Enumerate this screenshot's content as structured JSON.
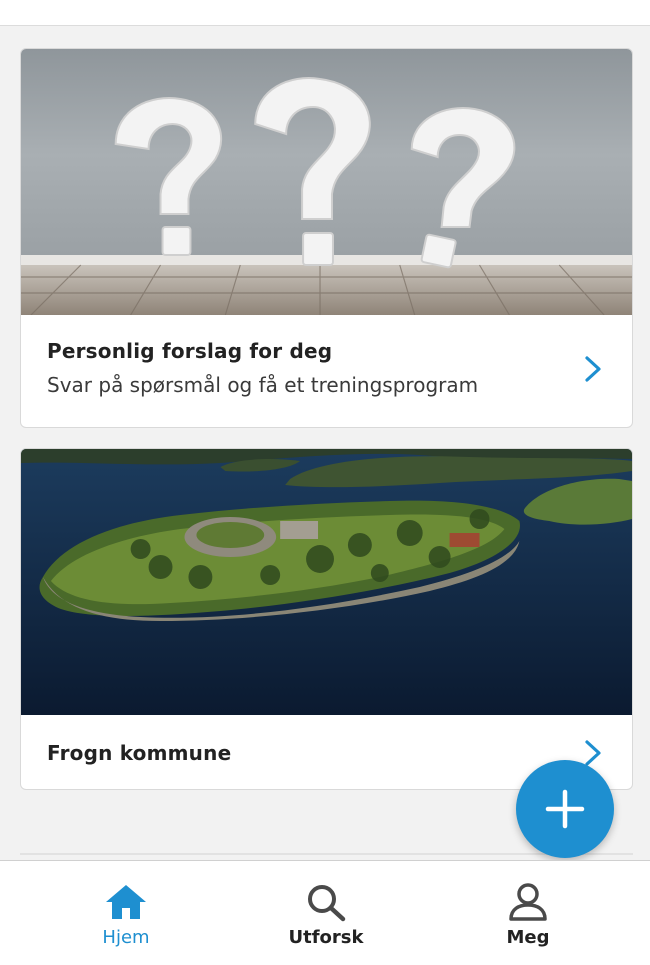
{
  "colors": {
    "accent": "#1e8fd0",
    "text_primary": "#222222",
    "text_secondary": "#3a3a3a",
    "background": "#f2f2f2"
  },
  "cards": [
    {
      "title": "Personlig forslag for deg",
      "subtitle": "Svar på spørsmål og få et treningsprogram",
      "image": "question-marks-image",
      "action_icon": "chevron-right-icon"
    },
    {
      "title": "Frogn kommune",
      "image": "island-fortress-aerial-image",
      "action_icon": "chevron-right-icon"
    }
  ],
  "fab": {
    "icon": "plus-icon"
  },
  "bottom_nav": {
    "items": [
      {
        "label": "Hjem",
        "icon": "home-icon",
        "active": true
      },
      {
        "label": "Utforsk",
        "icon": "search-icon",
        "active": false
      },
      {
        "label": "Meg",
        "icon": "user-icon",
        "active": false
      }
    ]
  }
}
